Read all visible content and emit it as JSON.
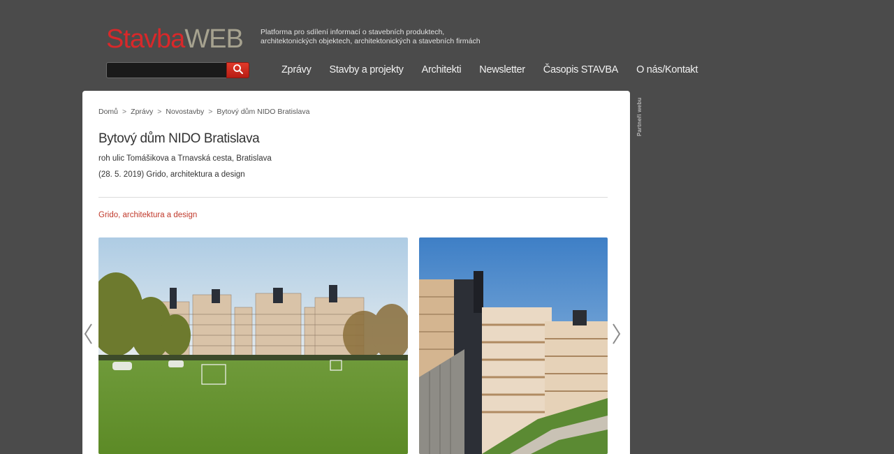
{
  "header": {
    "logo": {
      "part1": "Stavba",
      "part2": "WEB"
    },
    "tagline": {
      "line1": "Platforma pro sdílení informací o stavebních produktech,",
      "line2": "architektonických objektech, architektonických a stavebních firmách"
    },
    "search": {
      "value": "",
      "button_icon": "search-icon"
    },
    "nav": [
      "Zprávy",
      "Stavby a projekty",
      "Architekti",
      "Newsletter",
      "Časopis STAVBA",
      "O nás/Kontakt"
    ]
  },
  "breadcrumb": [
    "Domů",
    "Zprávy",
    "Novostavby",
    "Bytový dům NIDO Bratislava"
  ],
  "article": {
    "title": "Bytový dům NIDO Bratislava",
    "address": "roh ulic Tomášikova a Trnavská cesta, Bratislava",
    "dateline": "(28. 5. 2019) Grido, architektura a design",
    "author_link": "Grido, architektura a design"
  },
  "gallery": {
    "prev_icon": "chevron-left-icon",
    "next_icon": "chevron-right-icon"
  },
  "sidebar": {
    "partners_label": "Partneři webu"
  },
  "colors": {
    "page_bg": "#4b4b4b",
    "logo_red": "#d8282a",
    "logo_grey": "#a6a28f",
    "accent_link": "#c0392b",
    "search_button": "#c8281c"
  }
}
